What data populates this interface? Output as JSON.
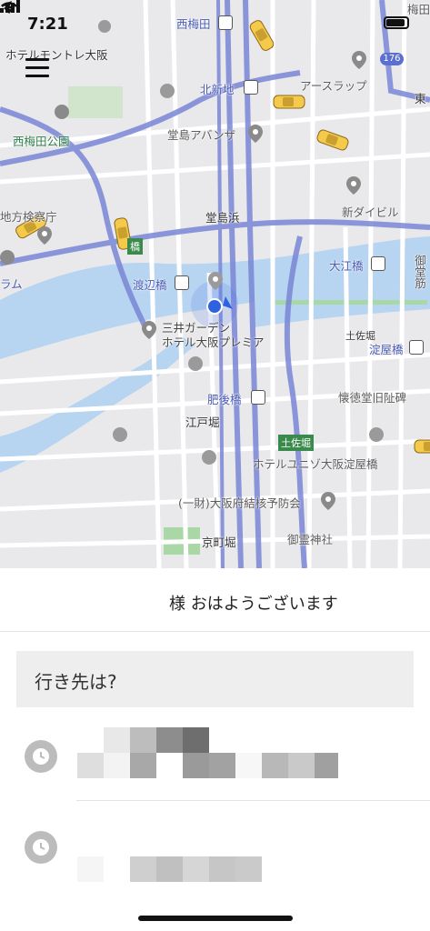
{
  "status_bar": {
    "time": "7:21"
  },
  "map": {
    "labels": {
      "nishiumeda_station": "西梅田",
      "hotel_monterey": "ホテルモントレ大阪",
      "kitashinchi": "北新地",
      "earth_slap": "アースラップ",
      "nishiumeda_park": "西梅田公園",
      "dojima_avanza": "堂島アバンザ",
      "dojimahama": "堂島浜",
      "shin_daibiru": "新ダイビル",
      "chiho_kensatsucho": "地方検察庁",
      "oebashi": "大江橋",
      "watanabebashi": "渡辺橋",
      "mitsui_garden": "三井ガーデン",
      "hotel_osaka_premier": "ホテル大阪プレミア",
      "tosabori_right": "土佐堀",
      "yodoyabashi": "淀屋橋",
      "higobashi": "肥後橋",
      "kaitokudo": "懐徳堂旧阯碑",
      "edobori": "江戸堀",
      "tosabori_badge": "土佐堀",
      "hotel_unizo": "ホテルユニゾ大阪淀屋橋",
      "kekkaku": "(一財)大阪府結核予防会",
      "goryo_jinja": "御霊神社",
      "kyomachibori": "京町堀",
      "midosuji": "御堂筋",
      "route_176": "176",
      "umeda": "梅田",
      "higashi": "東",
      "ram": "ラム",
      "bashi": "橋"
    }
  },
  "panel": {
    "greeting": "様 おはようございます",
    "search_placeholder": "行き先は?"
  }
}
